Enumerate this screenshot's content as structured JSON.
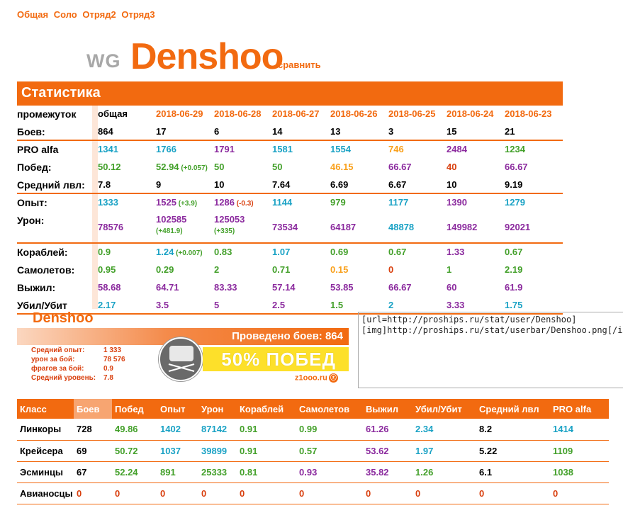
{
  "nav": [
    "Общая",
    "Соло",
    "Отряд2",
    "Отряд3"
  ],
  "header": {
    "prefix": "WG",
    "name": "Denshoo",
    "compare": "сравнить"
  },
  "stats": {
    "title": "Статистика",
    "period_label": "промежуток",
    "columns": [
      "общая",
      "2018-06-29",
      "2018-06-28",
      "2018-06-27",
      "2018-06-26",
      "2018-06-25",
      "2018-06-24",
      "2018-06-23"
    ],
    "rows": [
      {
        "label": "Боев:",
        "values": [
          "864",
          "17",
          "6",
          "14",
          "13",
          "3",
          "15",
          "21"
        ],
        "colors": [
          "black",
          "black",
          "black",
          "black",
          "black",
          "black",
          "black",
          "black"
        ],
        "deltas": [],
        "sep": true
      },
      {
        "label": "PRO alfa",
        "values": [
          "1341",
          "1766",
          "1791",
          "1581",
          "1554",
          "746",
          "2484",
          "1234"
        ],
        "colors": [
          "teal",
          "teal",
          "purple",
          "teal",
          "teal",
          "orange",
          "purple",
          "green"
        ],
        "deltas": []
      },
      {
        "label": "Побед:",
        "values": [
          "50.12",
          "52.94",
          "50",
          "50",
          "46.15",
          "66.67",
          "40",
          "66.67"
        ],
        "colors": [
          "green",
          "green",
          "green",
          "green",
          "orange",
          "purple",
          "red",
          "purple"
        ],
        "deltas": [
          null,
          "(+0.057)"
        ]
      },
      {
        "label": "Средний лвл:",
        "values": [
          "7.8",
          "9",
          "10",
          "7.64",
          "6.69",
          "6.67",
          "10",
          "9.19"
        ],
        "colors": [
          "black",
          "black",
          "black",
          "black",
          "black",
          "black",
          "black",
          "black"
        ],
        "deltas": [],
        "sep": true
      },
      {
        "label": "Опыт:",
        "values": [
          "1333",
          "1525",
          "1286",
          "1144",
          "979",
          "1177",
          "1390",
          "1279"
        ],
        "colors": [
          "teal",
          "purple",
          "purple",
          "teal",
          "green",
          "teal",
          "purple",
          "teal"
        ],
        "deltas": [
          null,
          "(+3.9)",
          "(-0.3)"
        ]
      },
      {
        "label": "Урон:",
        "values": [
          "78576",
          "102585",
          "125053",
          "73534",
          "64187",
          "48878",
          "149982",
          "92021"
        ],
        "colors": [
          "purple",
          "purple",
          "purple",
          "purple",
          "purple",
          "teal",
          "purple",
          "purple"
        ],
        "deltas": [
          null,
          "(+481.9)",
          "(+335)"
        ],
        "tall": true,
        "sep": true
      },
      {
        "label": "Кораблей:",
        "values": [
          "0.9",
          "1.24",
          "0.83",
          "1.07",
          "0.69",
          "0.67",
          "1.33",
          "0.67"
        ],
        "colors": [
          "green",
          "teal",
          "green",
          "teal",
          "green",
          "green",
          "purple",
          "green"
        ],
        "deltas": [
          null,
          "(+0.007)"
        ]
      },
      {
        "label": "Самолетов:",
        "values": [
          "0.95",
          "0.29",
          "2",
          "0.71",
          "0.15",
          "0",
          "1",
          "2.19"
        ],
        "colors": [
          "green",
          "green",
          "green",
          "green",
          "orange",
          "red",
          "green",
          "green"
        ],
        "deltas": []
      },
      {
        "label": "Выжил:",
        "values": [
          "58.68",
          "64.71",
          "83.33",
          "57.14",
          "53.85",
          "66.67",
          "60",
          "61.9"
        ],
        "colors": [
          "purple",
          "purple",
          "purple",
          "purple",
          "purple",
          "purple",
          "purple",
          "purple"
        ],
        "deltas": []
      },
      {
        "label": "Убил/Убит",
        "values": [
          "2.17",
          "3.5",
          "5",
          "2.5",
          "1.5",
          "2",
          "3.33",
          "1.75"
        ],
        "colors": [
          "teal",
          "purple",
          "purple",
          "purple",
          "green",
          "teal",
          "purple",
          "teal"
        ],
        "deltas": [],
        "sep": true
      }
    ]
  },
  "userbar": {
    "name": "Denshoo",
    "battles": "Проведено боев: 864",
    "lines": [
      {
        "k": "Средний опыт:",
        "v": "1 333"
      },
      {
        "k": "урон за бой:",
        "v": "78 576"
      },
      {
        "k": "фрагов за бой:",
        "v": "0.9"
      },
      {
        "k": "Средний уровень:",
        "v": "7.8"
      }
    ],
    "win": "50% ПОБЕД",
    "site": "z1ooo.ru",
    "site_icon": "ⓩ"
  },
  "code": {
    "line1": "[url=http://proships.ru/stat/user/Denshoo]",
    "line2": "[img]http://proships.ru/stat/userbar/Denshoo.png[/i"
  },
  "classes": {
    "headers": [
      "Класс",
      "Боев",
      "Побед",
      "Опыт",
      "Урон",
      "Кораблей",
      "Самолетов",
      "Выжил",
      "Убил/Убит",
      "Средний лвл",
      "PRO alfa"
    ],
    "rows": [
      {
        "name": "Линкоры",
        "values": [
          "728",
          "49.86",
          "1402",
          "87142",
          "0.91",
          "0.99",
          "61.26",
          "2.34",
          "8.2",
          "1414"
        ],
        "colors": [
          "black",
          "green",
          "teal",
          "teal",
          "green",
          "green",
          "purple",
          "teal",
          "black",
          "teal"
        ]
      },
      {
        "name": "Крейсера",
        "values": [
          "69",
          "50.72",
          "1037",
          "39899",
          "0.91",
          "0.57",
          "53.62",
          "1.97",
          "5.22",
          "1109"
        ],
        "colors": [
          "black",
          "green",
          "teal",
          "teal",
          "green",
          "green",
          "purple",
          "teal",
          "black",
          "green"
        ]
      },
      {
        "name": "Эсминцы",
        "values": [
          "67",
          "52.24",
          "891",
          "25333",
          "0.81",
          "0.93",
          "35.82",
          "1.26",
          "6.1",
          "1038"
        ],
        "colors": [
          "black",
          "green",
          "green",
          "green",
          "green",
          "purple",
          "purple",
          "green",
          "black",
          "green"
        ]
      },
      {
        "name": "Авианосцы",
        "values": [
          "0",
          "0",
          "0",
          "0",
          "0",
          "0",
          "0",
          "0",
          "0",
          "0"
        ],
        "colors": [
          "dred",
          "dred",
          "dred",
          "dred",
          "dred",
          "dred",
          "dred",
          "dred",
          "dred",
          "dred"
        ]
      }
    ]
  }
}
